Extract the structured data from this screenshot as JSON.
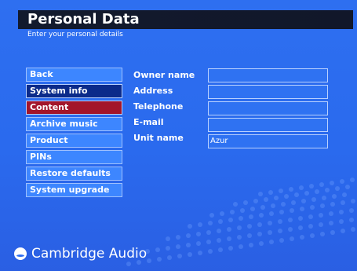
{
  "header": {
    "title": "Personal Data",
    "subtitle": "Enter your personal details"
  },
  "sidebar": {
    "items": [
      {
        "label": "Back"
      },
      {
        "label": "System info"
      },
      {
        "label": "Content"
      },
      {
        "label": "Archive music"
      },
      {
        "label": "Product"
      },
      {
        "label": "PINs"
      },
      {
        "label": "Restore defaults"
      },
      {
        "label": "System upgrade"
      }
    ]
  },
  "form": {
    "fields": [
      {
        "label": "Owner name",
        "value": ""
      },
      {
        "label": "Address",
        "value": ""
      },
      {
        "label": "Telephone",
        "value": ""
      },
      {
        "label": "E-mail",
        "value": ""
      },
      {
        "label": "Unit name",
        "value": "Azur"
      }
    ]
  },
  "brand": {
    "name": "Cambridge Audio"
  },
  "colors": {
    "background": "#2e6ff0",
    "title_bar": "#121a2d",
    "menu_item": "#3d86ff",
    "menu_selected": "#0b2a8a",
    "menu_active": "#a3152a",
    "input_border": "#b9d1ff"
  },
  "icons": {
    "brand_logo": "cambridge-audio-logo"
  }
}
